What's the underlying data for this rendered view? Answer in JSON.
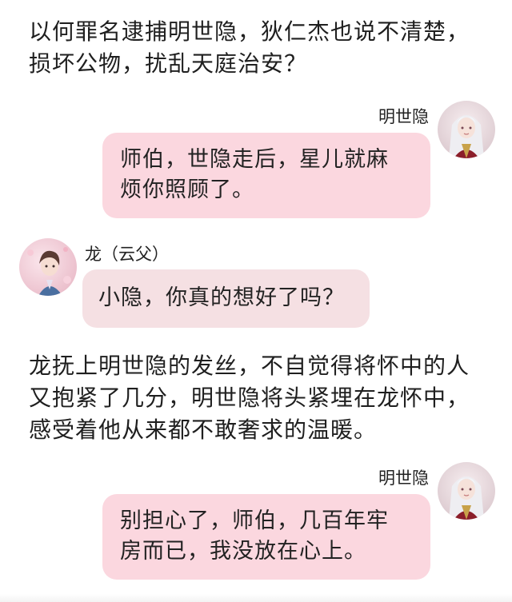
{
  "narration": [
    {
      "lines": [
        "以何罪名逮捕明世隐，狄仁杰也说不清楚，",
        "损坏公物，扰乱天庭治安？"
      ]
    },
    {
      "lines": [
        "龙抚上明世隐的发丝，不自觉得将怀中的人",
        "又抱紧了几分，明世隐将头紧埋在龙怀中，",
        "感受着他从来都不敢奢求的温暖。"
      ]
    }
  ],
  "messages": [
    {
      "speaker": "明世隐",
      "side": "right",
      "avatar_icon": "white-haired-character-avatar",
      "lines": [
        "师伯，世隐走后，星儿就麻",
        "烦你照顾了。"
      ]
    },
    {
      "speaker": "龙（云父）",
      "side": "left",
      "avatar_icon": "dark-haired-character-avatar",
      "lines": [
        "小隐，你真的想好了吗？"
      ]
    },
    {
      "speaker": "明世隐",
      "side": "right",
      "avatar_icon": "white-haired-character-avatar",
      "lines": [
        "别担心了，师伯，几百年牢",
        "房而已，我没放在心上。"
      ]
    }
  ],
  "colors": {
    "bubble_right": "#fbd7df",
    "bubble_left": "#f5e0e3",
    "background": "#ffffff"
  }
}
